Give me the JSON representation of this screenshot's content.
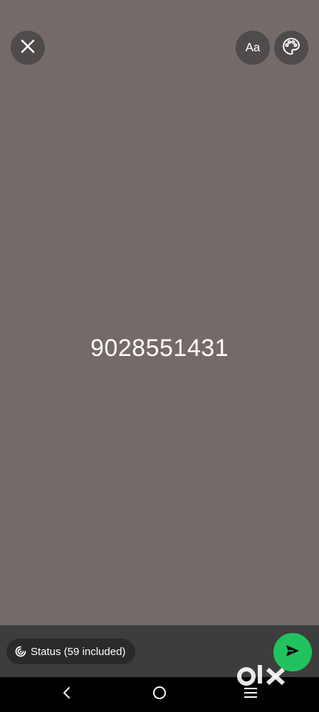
{
  "topbar": {
    "close_icon": "close-icon",
    "text_style_label": "Aa",
    "palette_icon": "palette-icon"
  },
  "composer": {
    "status_text": "9028551431",
    "background_color": "#746a6a"
  },
  "bottom": {
    "audience_label": "Status (59 included)",
    "audience_icon": "status-ring-icon",
    "send_icon": "send-icon",
    "send_color": "#22c35e"
  },
  "navbar": {
    "back_icon": "back-icon",
    "home_icon": "home-icon",
    "recents_icon": "recents-icon"
  },
  "watermark": {
    "brand": "olx"
  }
}
